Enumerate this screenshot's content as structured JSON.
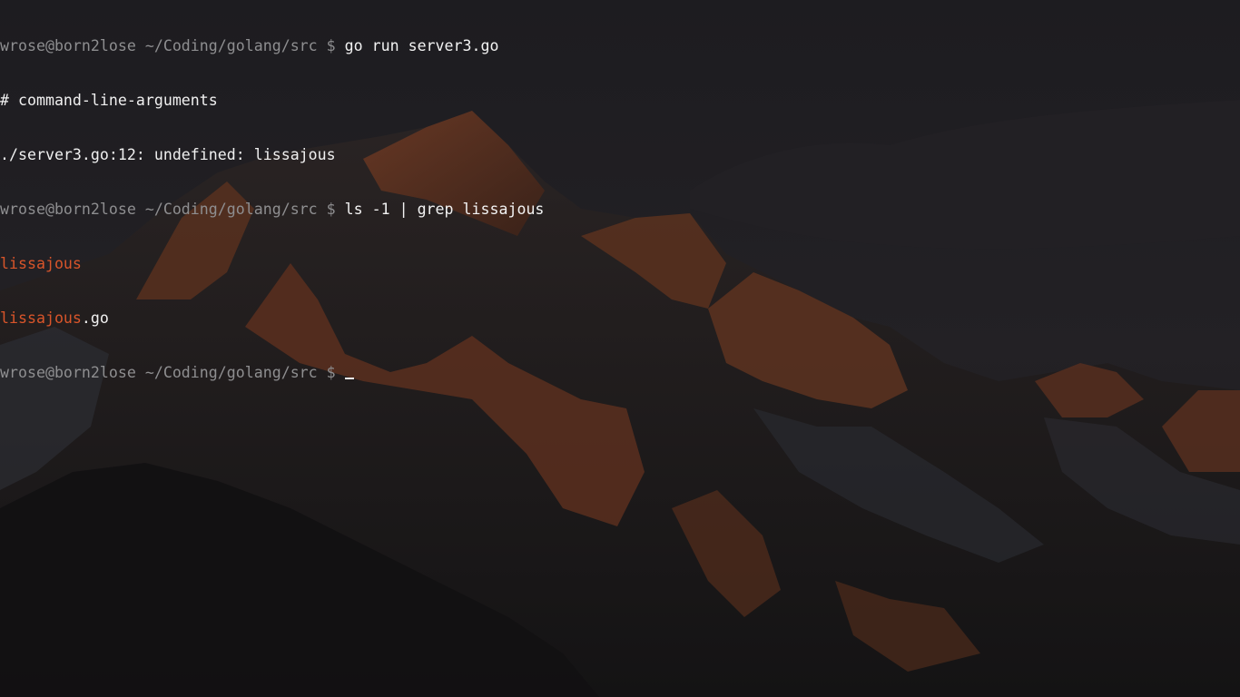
{
  "terminal": {
    "lines": [
      {
        "prompt": "wrose@born2lose ~/Coding/golang/src $ ",
        "command": "go run server3.go"
      },
      {
        "output": "# command-line-arguments"
      },
      {
        "output": "./server3.go:12: undefined: lissajous"
      },
      {
        "prompt": "wrose@born2lose ~/Coding/golang/src $ ",
        "command": "ls -1 | grep lissajous"
      },
      {
        "match": "lissajous"
      },
      {
        "match": "lissajous",
        "rest": ".go"
      },
      {
        "prompt": "wrose@born2lose ~/Coding/golang/src $ ",
        "command": ""
      }
    ]
  },
  "colors": {
    "prompt": "#8e8e90",
    "text": "#f0f0f0",
    "grep_match": "#d9552a",
    "background": "#1e1d21"
  },
  "wallpaper": {
    "subject": "mountain-at-dusk"
  }
}
